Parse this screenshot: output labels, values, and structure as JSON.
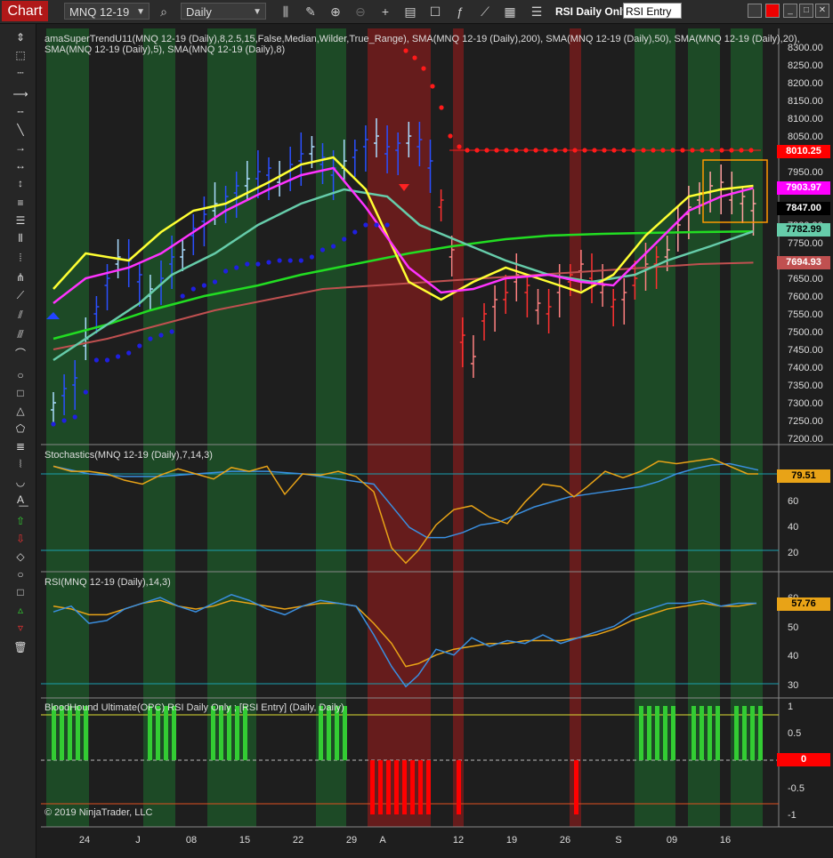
{
  "toolbar": {
    "chart_tab": "Chart",
    "instrument": "MNQ 12-19",
    "period": "Daily",
    "rsi_label": "RSI Daily Only",
    "rsi_entry": "RSI Entry",
    "icons": [
      "search-icon",
      "bar-type-icon",
      "pencil-icon",
      "zoom-in-icon",
      "zoom-out-icon",
      "crosshair-icon",
      "properties-icon",
      "data-box-icon",
      "indicators-icon",
      "strategies-icon",
      "templates-icon"
    ]
  },
  "panels": {
    "price": {
      "label": "amaSuperTrendU11(MNQ 12-19 (Daily),8,2.5,15,False,Median,Wilder,True_Range), SMA(MNQ 12-19 (Daily),200), SMA(MNQ 12-19 (Daily),50), SMA(MNQ 12-19 (Daily),20),",
      "label2": "SMA(MNQ 12-19 (Daily),5), SMA(MNQ 12-19 (Daily),8)",
      "axis": [
        "8300.00",
        "8250.00",
        "8200.00",
        "8150.00",
        "8100.00",
        "8050.00",
        "8000.00",
        "7950.00",
        "7900.00",
        "7850.00",
        "7800.00",
        "7750.00",
        "7700.00",
        "7650.00",
        "7600.00",
        "7550.00",
        "7500.00",
        "7450.00",
        "7400.00",
        "7350.00",
        "7300.00",
        "7250.00",
        "7200.00"
      ],
      "markers": [
        {
          "value": "8010.25",
          "color": "#ff0000",
          "text": "#ffffff"
        },
        {
          "value": "7903.97",
          "color": "#ff00ff",
          "text": "#ffffff"
        },
        {
          "value": "7847.00",
          "color": "#000000",
          "text": "#ffffff"
        },
        {
          "value": "7782.99",
          "color": "#66ccaa",
          "text": "#000000"
        },
        {
          "value": "7694.93",
          "color": "#c05050",
          "text": "#ffffff"
        }
      ]
    },
    "stochastics": {
      "label": "Stochastics(MNQ 12-19 (Daily),7,14,3)",
      "axis": [
        "80",
        "60",
        "40",
        "20"
      ],
      "markers": [
        {
          "value": "79.51",
          "color": "#e8a317",
          "text": "#000000"
        }
      ]
    },
    "rsi": {
      "label": "RSI(MNQ 12-19 (Daily),14,3)",
      "axis": [
        "60",
        "50",
        "40",
        "30"
      ],
      "markers": [
        {
          "value": "57.76",
          "color": "#e8a317",
          "text": "#000000"
        }
      ]
    },
    "bloodhound": {
      "label": "BloodHound Ultimate(OPC) RSI Daily Only ; [RSI Entry] (Daily, Daily)",
      "axis": [
        "1",
        "0.5",
        "0",
        "-0.5",
        "-1"
      ],
      "markers": [
        {
          "value": "0",
          "color": "#ff0000",
          "text": "#ffffff"
        }
      ],
      "copyright": "© 2019 NinjaTrader, LLC"
    }
  },
  "x_axis": [
    "24",
    "J",
    "08",
    "15",
    "22",
    "29",
    "A",
    "12",
    "19",
    "26",
    "S",
    "09",
    "16"
  ],
  "colors": {
    "bg": "#1e1e1e",
    "green_band": "#1d5a2a",
    "red_band": "#6e1c1c",
    "sma200": "#c05050",
    "sma50": "#22dd22",
    "sma20": "#66ccaa",
    "sma5": "#ffff33",
    "sma8": "#ff33ff",
    "supertrend_up": "#1f1fe0",
    "supertrend_down": "#ff1a1a",
    "stoch_k": "#e8a317",
    "stoch_d": "#3a8fe0",
    "bull_signal": "#33cc33",
    "bear_signal": "#ff0000"
  }
}
